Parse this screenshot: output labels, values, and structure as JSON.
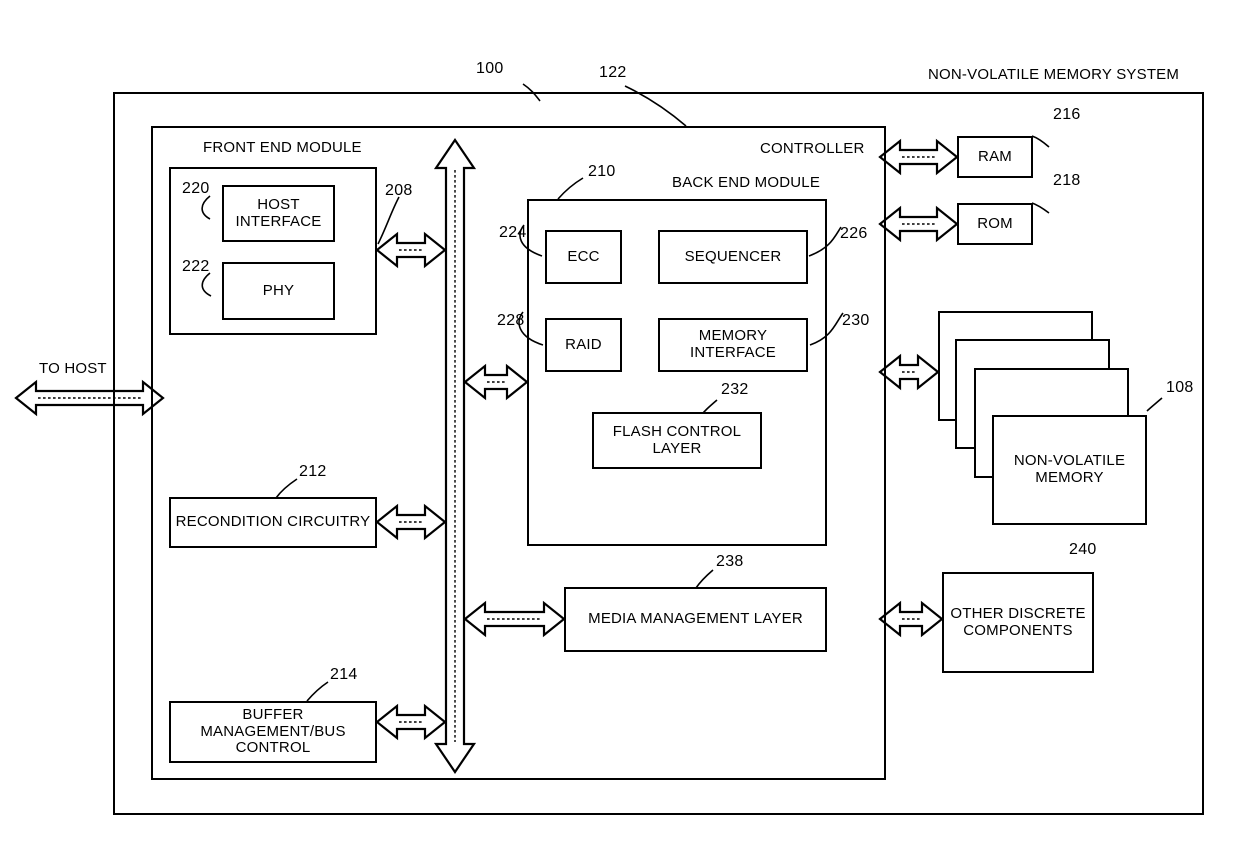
{
  "diagram": {
    "title": "NON-VOLATILE MEMORY SYSTEM",
    "system_ref": "100",
    "controller_ref": "122"
  },
  "labels": {
    "system_title": "NON-VOLATILE MEMORY SYSTEM",
    "controller": "CONTROLLER",
    "front_end_module": "FRONT END MODULE",
    "back_end_module": "BACK END MODULE",
    "to_host": "TO HOST"
  },
  "blocks": {
    "host_interface": "HOST\nINTERFACE",
    "host_interface_line1": "HOST",
    "host_interface_line2": "INTERFACE",
    "phy": "PHY",
    "recondition_circuitry": "RECONDITION CIRCUITRY",
    "buffer_management_line1": "BUFFER MANAGEMENT/BUS",
    "buffer_management_line2": "CONTROL",
    "ecc": "ECC",
    "sequencer": "SEQUENCER",
    "raid": "RAID",
    "memory_interface_line1": "MEMORY",
    "memory_interface_line2": "INTERFACE",
    "flash_control_layer_line1": "FLASH CONTROL",
    "flash_control_layer_line2": "LAYER",
    "media_management_layer": "MEDIA MANAGEMENT LAYER",
    "ram": "RAM",
    "rom": "ROM",
    "non_volatile_memory_line1": "NON-VOLATILE",
    "non_volatile_memory_line2": "MEMORY",
    "other_discrete_line1": "OTHER DISCRETE",
    "other_discrete_line2": "COMPONENTS"
  },
  "reference_numerals": {
    "system": "100",
    "controller": "122",
    "front_end_bus": "208",
    "back_end_module": "210",
    "recondition_circuitry": "212",
    "buffer_management": "214",
    "ram": "216",
    "rom": "218",
    "host_interface": "220",
    "phy": "222",
    "ecc": "224",
    "sequencer": "226",
    "raid": "228",
    "memory_interface": "230",
    "flash_control_layer": "232",
    "media_management_layer": "238",
    "other_discrete_components": "240",
    "non_volatile_memory": "108"
  },
  "colors": {
    "stroke": "#000000",
    "background": "#ffffff"
  }
}
